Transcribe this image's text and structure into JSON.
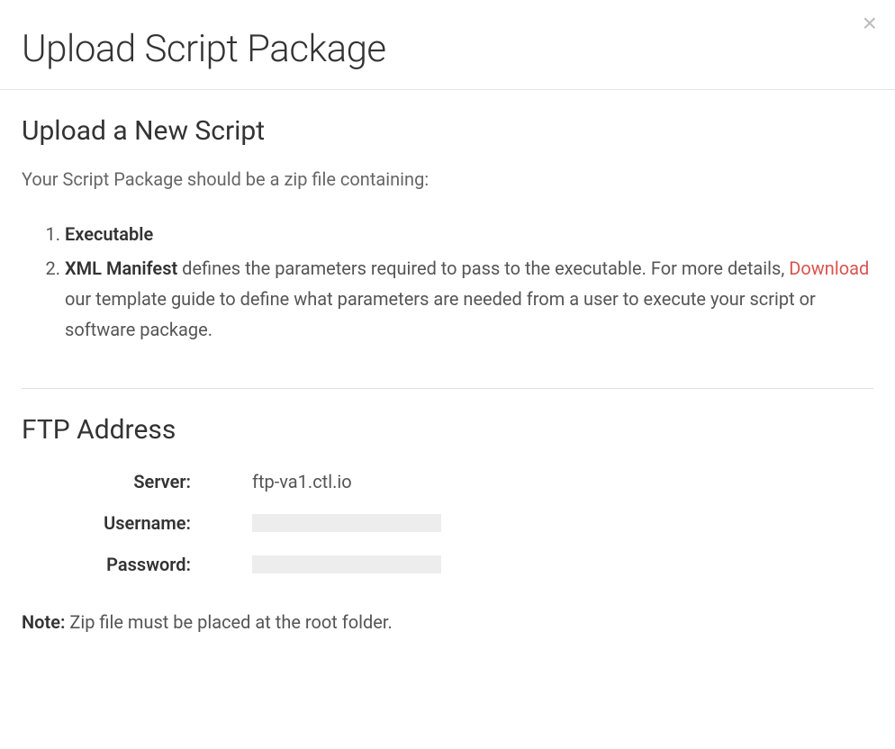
{
  "header": {
    "title": "Upload Script Package"
  },
  "upload_section": {
    "title": "Upload a New Script",
    "intro": "Your Script Package should be a zip file containing:",
    "items": {
      "executable": {
        "label": "Executable"
      },
      "xml_manifest": {
        "label": "XML Manifest",
        "desc_before": " defines the parameters required to pass to the executable. For more details, ",
        "download_text": "Download",
        "desc_after": " our template guide to define what parameters are needed from a user to execute your script or software package."
      }
    }
  },
  "ftp": {
    "title": "FTP Address",
    "server_label": "Server:",
    "server_value": "ftp-va1.ctl.io",
    "username_label": "Username:",
    "password_label": "Password:"
  },
  "note": {
    "label": "Note:",
    "text": " Zip file must be placed at the root folder."
  }
}
